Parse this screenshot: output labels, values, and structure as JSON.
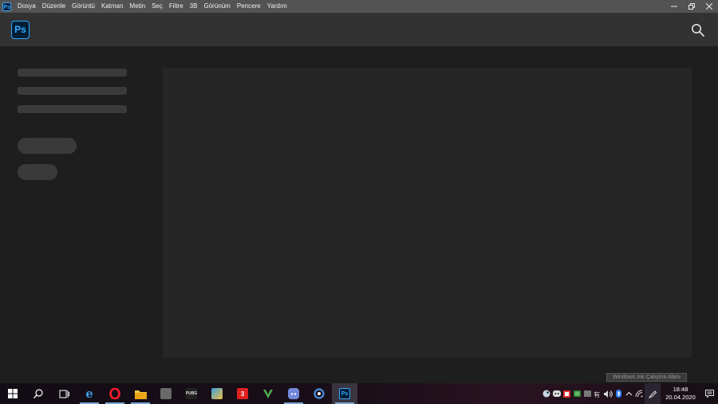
{
  "menubar": {
    "app_icon": "Ps",
    "items": [
      "Dosya",
      "Düzenle",
      "Görüntü",
      "Katman",
      "Metin",
      "Seç",
      "Filtre",
      "3B",
      "Görünüm",
      "Pencere",
      "Yardım"
    ]
  },
  "header": {
    "logo": "Ps",
    "search_icon": "search-icon"
  },
  "watermark": "Windows Ink Çalışma Alanı",
  "taskbar": {
    "apps": [
      {
        "name": "start",
        "icon": "windows-icon"
      },
      {
        "name": "search",
        "icon": "search-icon"
      },
      {
        "name": "task-view",
        "icon": "task-view-icon"
      },
      {
        "name": "edge",
        "icon": "edge-icon"
      },
      {
        "name": "opera",
        "icon": "opera-icon"
      },
      {
        "name": "file-explorer",
        "icon": "folder-icon"
      },
      {
        "name": "app-6",
        "icon": "game-icon"
      },
      {
        "name": "pubg",
        "icon": "pubg-icon",
        "label": "PUBG"
      },
      {
        "name": "app-8",
        "icon": "game-icon"
      },
      {
        "name": "app-9",
        "icon": "game-icon"
      },
      {
        "name": "app-10",
        "icon": "v-icon"
      },
      {
        "name": "discord",
        "icon": "discord-icon"
      },
      {
        "name": "app-12",
        "icon": "circle-icon"
      },
      {
        "name": "photoshop",
        "icon": "photoshop-icon",
        "label": "Ps"
      }
    ],
    "clock": {
      "time": "18:48",
      "date": "20.04.2020"
    }
  },
  "colors": {
    "ps_blue": "#31a8ff",
    "menubar_bg": "#535353",
    "header_bg": "#323232",
    "body_bg": "#1e1e1e",
    "panel_bg": "#262626"
  }
}
